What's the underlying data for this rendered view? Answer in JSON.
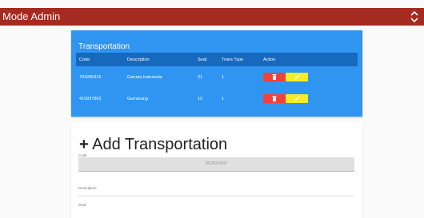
{
  "header": {
    "title": "Mode Admin"
  },
  "transportation": {
    "title": "Transportation",
    "columns": [
      "Code",
      "Description",
      "Seat",
      "Trans Type",
      "Action"
    ],
    "rows": [
      {
        "code": "794285316",
        "description": "Garuda Indonesia",
        "seat": "21",
        "trans_type": "1"
      },
      {
        "code": "415937862",
        "description": "Gumarang",
        "seat": "12",
        "trans_type": "1"
      }
    ]
  },
  "form": {
    "title": "Add Transportation",
    "plus": "+",
    "code_label": "Code",
    "code_value": "993631847",
    "description_label": "Description",
    "seat_label": "Seat"
  },
  "colors": {
    "header": "#a52a20",
    "panel": "#2f95f0",
    "table_header": "#1769bd",
    "delete": "#f2413d",
    "edit": "#f5eb2a"
  },
  "icons": {
    "menu": "chevron-updown-icon",
    "delete": "trash-icon",
    "edit": "pencil-icon"
  }
}
